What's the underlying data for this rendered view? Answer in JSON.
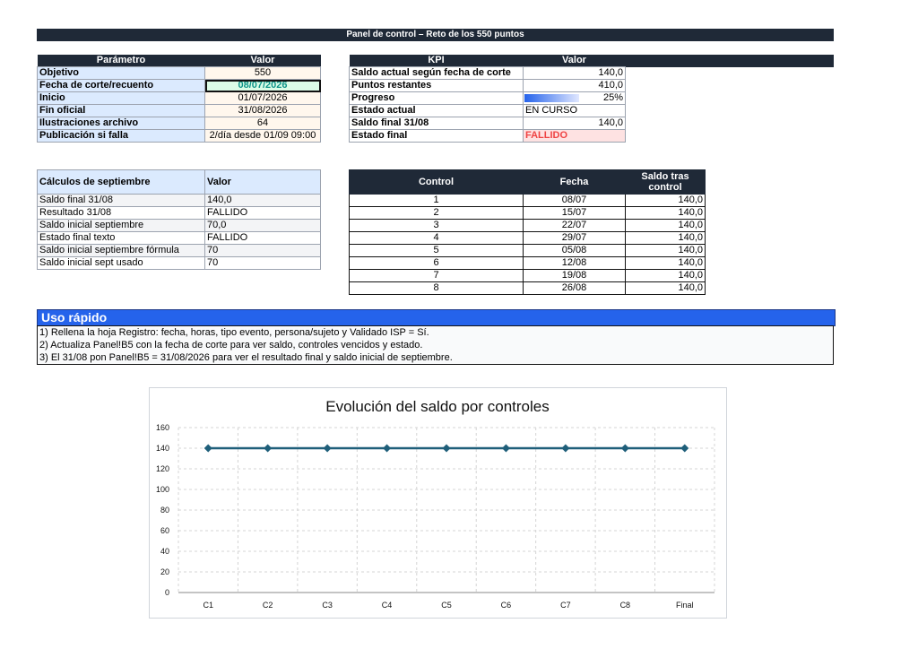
{
  "banner": "Panel de control – Reto de los 550 puntos",
  "params": {
    "headers": [
      "Parámetro",
      "Valor"
    ],
    "rows": [
      {
        "label": "Objetivo",
        "value": "550"
      },
      {
        "label": "Fecha de corte/recuento",
        "value": "08/07/2026"
      },
      {
        "label": "Inicio",
        "value": "01/07/2026"
      },
      {
        "label": "Fin oficial",
        "value": "31/08/2026"
      },
      {
        "label": "Ilustraciones archivo",
        "value": "64"
      },
      {
        "label": "Publicación si falla",
        "value": "2/día desde 01/09 09:00"
      }
    ]
  },
  "kpi": {
    "headers": [
      "KPI",
      "Valor"
    ],
    "rows": [
      {
        "label": "Saldo actual según fecha de corte",
        "value": "140,0"
      },
      {
        "label": "Puntos restantes",
        "value": "410,0"
      },
      {
        "label": "Progreso",
        "value": "25%",
        "progress": 0.25
      },
      {
        "label": "Estado actual",
        "value": "EN CURSO"
      },
      {
        "label": "Saldo final 31/08",
        "value": "140,0"
      },
      {
        "label": "Estado final",
        "value": "FALLIDO"
      }
    ]
  },
  "septiembre": {
    "headers": [
      "Cálculos de septiembre",
      "Valor"
    ],
    "rows": [
      {
        "label": "Saldo final 31/08",
        "value": "140,0"
      },
      {
        "label": "Resultado 31/08",
        "value": "FALLIDO"
      },
      {
        "label": "Saldo inicial septiembre",
        "value": "70,0"
      },
      {
        "label": "Estado final texto",
        "value": "FALLIDO"
      },
      {
        "label": "Saldo inicial septiembre fórmula",
        "value": "70"
      },
      {
        "label": "Saldo inicial sept usado",
        "value": "70"
      }
    ]
  },
  "controles": {
    "headers": [
      "Control",
      "Fecha",
      "Saldo tras control"
    ],
    "rows": [
      {
        "n": "1",
        "fecha": "08/07",
        "saldo": "140,0"
      },
      {
        "n": "2",
        "fecha": "15/07",
        "saldo": "140,0"
      },
      {
        "n": "3",
        "fecha": "22/07",
        "saldo": "140,0"
      },
      {
        "n": "4",
        "fecha": "29/07",
        "saldo": "140,0"
      },
      {
        "n": "5",
        "fecha": "05/08",
        "saldo": "140,0"
      },
      {
        "n": "6",
        "fecha": "12/08",
        "saldo": "140,0"
      },
      {
        "n": "7",
        "fecha": "19/08",
        "saldo": "140,0"
      },
      {
        "n": "8",
        "fecha": "26/08",
        "saldo": "140,0"
      }
    ]
  },
  "uso": {
    "title": "Uso rápido",
    "lines": [
      "1) Rellena la hoja Registro: fecha, horas, tipo evento, persona/sujeto y Validado ISP = Sí.",
      "2) Actualiza Panel!B5 con la fecha de corte para ver saldo, controles vencidos y estado.",
      "3) El 31/08 pon Panel!B5 = 31/08/2026 para ver el resultado final y saldo inicial de septiembre."
    ]
  },
  "chart_data": {
    "type": "line",
    "title": "Evolución del saldo por controles",
    "categories": [
      "C1",
      "C2",
      "C3",
      "C4",
      "C5",
      "C6",
      "C7",
      "C8",
      "Final"
    ],
    "series": [
      {
        "values": [
          140,
          140,
          140,
          140,
          140,
          140,
          140,
          140,
          140
        ],
        "color": "#1f5f7a"
      }
    ],
    "ylim": [
      0,
      160
    ],
    "yticks": [
      0,
      20,
      40,
      60,
      80,
      100,
      120,
      140,
      160
    ],
    "grid": true,
    "legend": "none"
  }
}
